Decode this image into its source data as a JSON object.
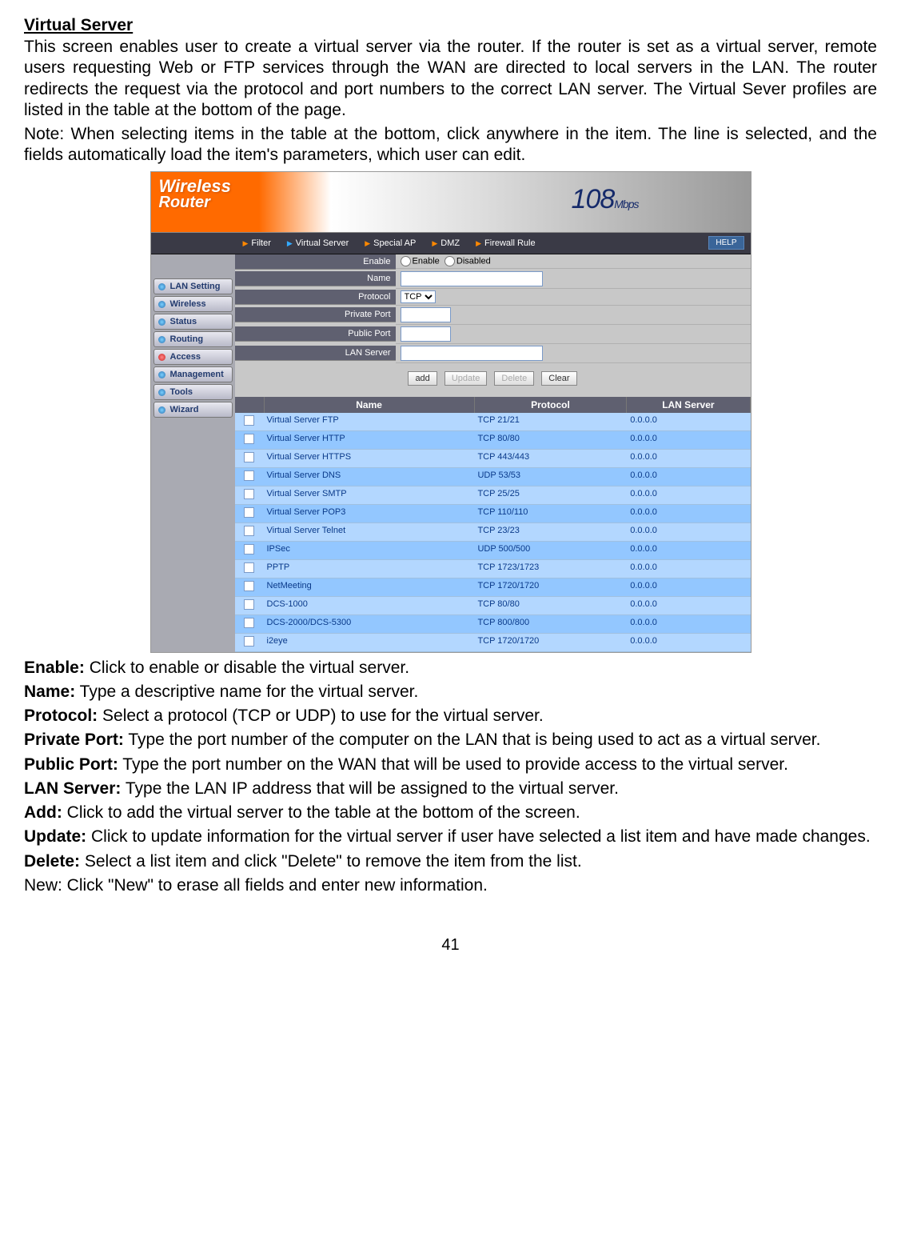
{
  "heading": "Virtual Server",
  "intro1": "This screen enables user to create a virtual server via the router. If the router is set as a virtual server, remote users requesting Web or FTP services through the WAN are directed to local servers in the LAN. The router redirects the request via the protocol and port numbers to the correct LAN server. The Virtual Sever profiles are listed in the table at the bottom of the page.",
  "intro2": "Note: When selecting items in the table at the bottom, click anywhere in the item. The line is selected, and the fields automatically load the item's parameters, which user can edit.",
  "banner": {
    "logo1": "Wireless",
    "logo2": "Router",
    "speed": "108",
    "unit": "Mbps"
  },
  "nav": {
    "items": [
      "Filter",
      "Virtual Server",
      "Special AP",
      "DMZ",
      "Firewall Rule"
    ],
    "help": "HELP"
  },
  "sidenav": [
    "LAN Setting",
    "Wireless",
    "Status",
    "Routing",
    "Access",
    "Management",
    "Tools",
    "Wizard"
  ],
  "form": {
    "enable_lbl": "Enable",
    "enable_opt1": "Enable",
    "enable_opt2": "Disabled",
    "name_lbl": "Name",
    "protocol_lbl": "Protocol",
    "protocol_val": "TCP",
    "private_lbl": "Private Port",
    "public_lbl": "Public Port",
    "lan_lbl": "LAN Server"
  },
  "buttons": {
    "add": "add",
    "update": "Update",
    "delete": "Delete",
    "clear": "Clear"
  },
  "table": {
    "headers": [
      "",
      "Name",
      "Protocol",
      "LAN Server"
    ],
    "rows": [
      {
        "name": "Virtual Server FTP",
        "proto": "TCP 21/21",
        "lan": "0.0.0.0"
      },
      {
        "name": "Virtual Server HTTP",
        "proto": "TCP 80/80",
        "lan": "0.0.0.0"
      },
      {
        "name": "Virtual Server HTTPS",
        "proto": "TCP 443/443",
        "lan": "0.0.0.0"
      },
      {
        "name": "Virtual Server DNS",
        "proto": "UDP 53/53",
        "lan": "0.0.0.0"
      },
      {
        "name": "Virtual Server SMTP",
        "proto": "TCP 25/25",
        "lan": "0.0.0.0"
      },
      {
        "name": "Virtual Server POP3",
        "proto": "TCP 110/110",
        "lan": "0.0.0.0"
      },
      {
        "name": "Virtual Server Telnet",
        "proto": "TCP 23/23",
        "lan": "0.0.0.0"
      },
      {
        "name": "IPSec",
        "proto": "UDP 500/500",
        "lan": "0.0.0.0"
      },
      {
        "name": "PPTP",
        "proto": "TCP 1723/1723",
        "lan": "0.0.0.0"
      },
      {
        "name": "NetMeeting",
        "proto": "TCP 1720/1720",
        "lan": "0.0.0.0"
      },
      {
        "name": "DCS-1000",
        "proto": "TCP 80/80",
        "lan": "0.0.0.0"
      },
      {
        "name": "DCS-2000/DCS-5300",
        "proto": "TCP 800/800",
        "lan": "0.0.0.0"
      },
      {
        "name": "i2eye",
        "proto": "TCP 1720/1720",
        "lan": "0.0.0.0"
      }
    ]
  },
  "desc": {
    "enable_b": "Enable:",
    "enable_t": " Click to enable or disable the virtual server.",
    "name_b": "Name:",
    "name_t": " Type a descriptive name for the virtual server.",
    "protocol_b": "Protocol:",
    "protocol_t": " Select a protocol (TCP or UDP) to use for the virtual server.",
    "private_b": "Private Port:",
    "private_t": " Type the port number of the computer on the LAN that is being used to act as a virtual server.",
    "public_b": "Public Port:",
    "public_t": " Type the port number on the WAN that will be used to provide access to the virtual server.",
    "lan_b": "LAN Server:",
    "lan_t": " Type the LAN IP address that will be assigned to the virtual server.",
    "add_b": "Add:",
    "add_t": " Click to add the virtual server to the table at the bottom of the screen.",
    "update_b": "Update:",
    "update_t": " Click to update information for the virtual server if user have selected a list item and have made changes.",
    "delete_b": "Delete:",
    "delete_t": " Select a list item and click \"Delete\" to remove the item from the list.",
    "new_t": "New: Click \"New\" to erase all fields and enter new information."
  },
  "pageno": "41"
}
